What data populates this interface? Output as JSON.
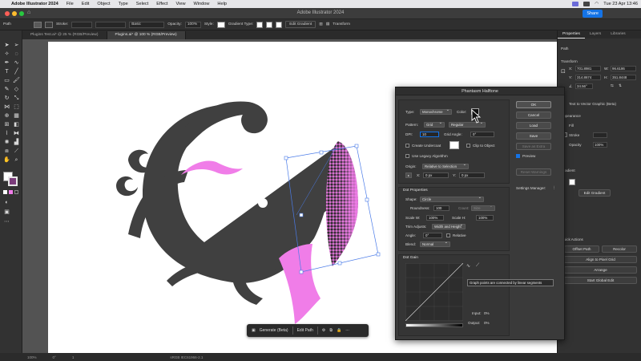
{
  "menubar": {
    "app_name": "Adobe Illustrator 2024",
    "items": [
      "File",
      "Edit",
      "Object",
      "Type",
      "Select",
      "Effect",
      "View",
      "Window",
      "Help"
    ],
    "clock": "Tue 23 Apr 13:46"
  },
  "titlebar": {
    "title": "Adobe Illustrator 2024",
    "share_label": "Share"
  },
  "controlbar": {
    "selection": "Path",
    "stroke_label": "Stroke:",
    "brush_label": "Basic",
    "opacity_label": "Opacity:",
    "opacity_value": "100%",
    "style_label": "Style:",
    "gradient_type_label": "Gradient Type:",
    "edit_gradient_label": "Edit Gradient",
    "transform_label": "Transform"
  },
  "tabs": [
    {
      "label": "Plugins Test.ai* @ 25 % (RGB/Preview)",
      "active": false
    },
    {
      "label": "Plugins.ai* @ 100 % (RGB/Preview)",
      "active": true
    }
  ],
  "status": {
    "zoom": "100%",
    "rotation": "0°",
    "artboard": "1",
    "profile": "sRGB IEC61966-2.1"
  },
  "context_bar": {
    "generate": "Generate (Beta)",
    "edit_path": "Edit Path"
  },
  "right_panel": {
    "tabs": [
      "Properties",
      "Layers",
      "Libraries"
    ],
    "selection": "Path",
    "transform_title": "Transform",
    "x_value": "701.8981",
    "w_value": "96.6186",
    "y_value": "314.8674",
    "h_value": "351.8448",
    "angle_value": "34.56°",
    "text_to_vector": "Text to Vector Graphic (Beta)",
    "appearance_title": "Appearance",
    "fill_label": "Fill",
    "stroke_label": "Stroke",
    "opacity_label": "Opacity",
    "opacity_value": "100%",
    "gradient_title": "Gradient",
    "edit_gradient": "Edit Gradient",
    "quick_actions_title": "Quick Actions",
    "offset_path": "Offset Path",
    "recolor": "Recolor",
    "align_pixel_grid": "Align to Pixel Grid",
    "arrange": "Arrange",
    "start_global_edit": "Start Global Edit"
  },
  "dialog": {
    "title": "Phantasm Halftone",
    "type_label": "Type:",
    "type_value": "Monochrome",
    "color_label": "Color:",
    "pattern_label": "Pattern:",
    "pattern_value": "Grid",
    "pattern_mode": "Regular",
    "dpi_label": "DPI:",
    "dpi_value": "10",
    "grid_angle_label": "Grid Angle:",
    "grid_angle_value": "0°",
    "create_undercoat": "Create Undercoat",
    "clip_to_object": "Clip to Object",
    "use_legacy": "Use Legacy Algorithm",
    "origin_label": "Origin:",
    "origin_value": "Relative to Selection",
    "x_label": "X:",
    "x_value": "0 px",
    "y_label": "Y:",
    "y_value": "0 px",
    "dot_properties": "Dot Properties",
    "shape_label": "Shape:",
    "shape_value": "Circle",
    "roundness_label": "Roundness:",
    "roundness_value": "100",
    "count_label": "Count:",
    "count_value": "Size",
    "scale_w_label": "Scale W:",
    "scale_w_value": "100%",
    "scale_h_label": "Scale H:",
    "scale_h_value": "100%",
    "trim_label": "Trim Adjusts:",
    "trim_value": "Width and Height",
    "angle_label": "Angle:",
    "angle_value": "0°",
    "relative_label": "Relative",
    "blend_label": "Blend:",
    "blend_value": "Normal",
    "dot_gain": "Dot Gain",
    "input_label": "Input:",
    "input_value": "0%",
    "output_label": "Output:",
    "output_value": "0%",
    "settings_manager": "Settings Manager:",
    "buttons": {
      "ok": "OK",
      "cancel": "Cancel",
      "load": "Load",
      "save": "Save",
      "save_as": "Save as Extra",
      "preview": "Preview",
      "reset": "Reset Warnings"
    },
    "tooltip": "Graph points are connected by linear segments"
  },
  "colors": {
    "pink": "#f07de8",
    "ink": "#404040",
    "accent": "#1473e6"
  }
}
